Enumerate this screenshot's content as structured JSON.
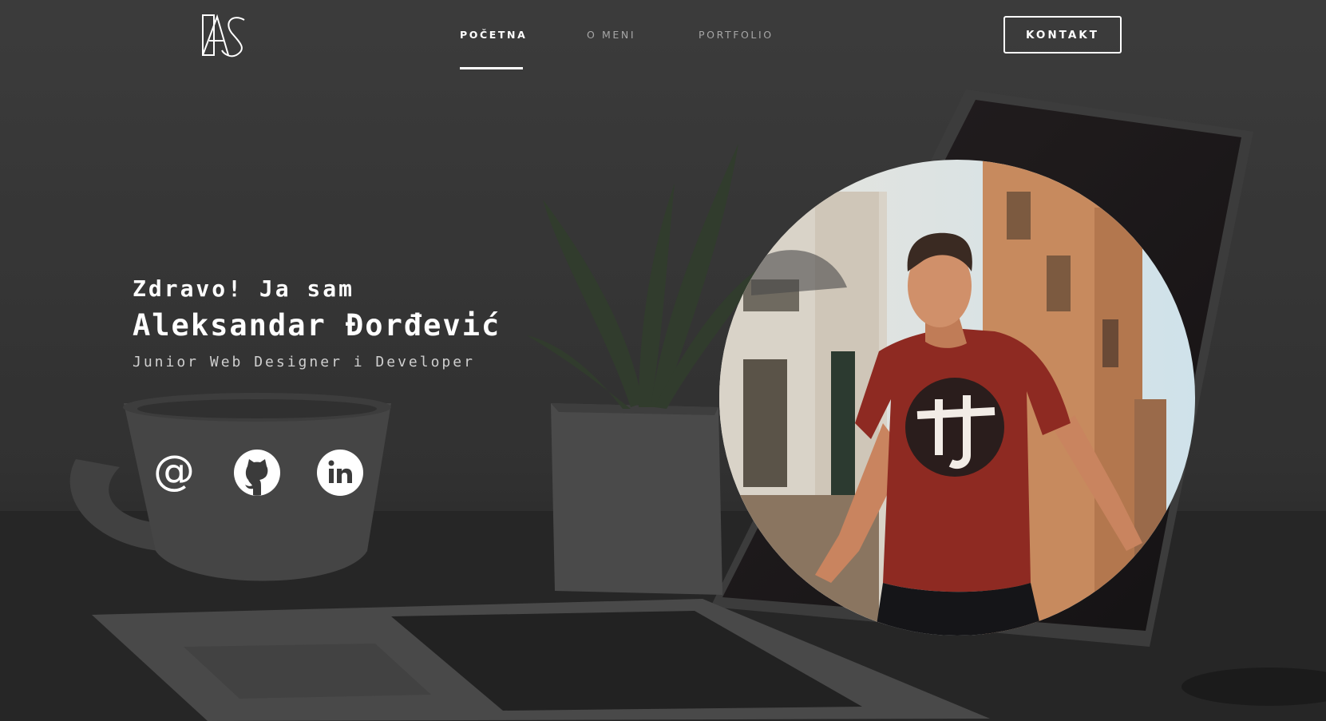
{
  "brand": {
    "logo_text": "AS",
    "name": "Aleksandar Đorđević"
  },
  "nav": {
    "items": [
      {
        "label": "POČETNA",
        "active": true
      },
      {
        "label": "O MENI",
        "active": false
      },
      {
        "label": "PORTFOLIO",
        "active": false
      }
    ],
    "contact_label": "KONTAKT"
  },
  "hero": {
    "greeting": "Zdravo! Ja sam",
    "name": "Aleksandar Đorđević",
    "role": "Junior Web Designer i Developer"
  },
  "social": [
    {
      "icon": "at-sign-icon"
    },
    {
      "icon": "github-icon"
    },
    {
      "icon": "linkedin-icon"
    }
  ],
  "colors": {
    "text": "#ffffff",
    "nav_inactive": "#a6a6a6",
    "background": "#3b3b3b",
    "shirt": "#8e2a22"
  }
}
